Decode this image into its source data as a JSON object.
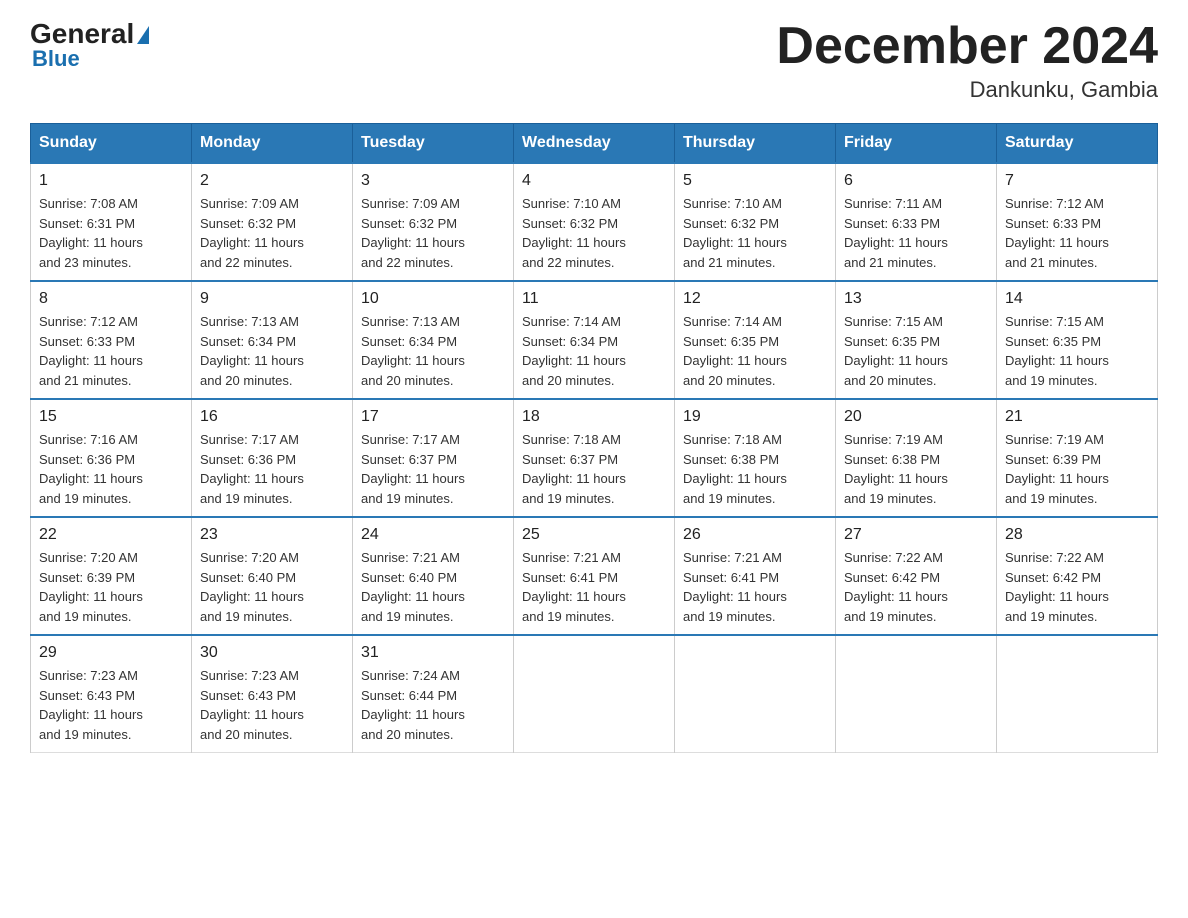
{
  "logo": {
    "general": "General",
    "blue": "Blue",
    "arrow": "▶"
  },
  "title": {
    "month_year": "December 2024",
    "location": "Dankunku, Gambia"
  },
  "headers": [
    "Sunday",
    "Monday",
    "Tuesday",
    "Wednesday",
    "Thursday",
    "Friday",
    "Saturday"
  ],
  "weeks": [
    [
      {
        "day": "1",
        "sunrise": "7:08 AM",
        "sunset": "6:31 PM",
        "daylight": "11 hours and 23 minutes."
      },
      {
        "day": "2",
        "sunrise": "7:09 AM",
        "sunset": "6:32 PM",
        "daylight": "11 hours and 22 minutes."
      },
      {
        "day": "3",
        "sunrise": "7:09 AM",
        "sunset": "6:32 PM",
        "daylight": "11 hours and 22 minutes."
      },
      {
        "day": "4",
        "sunrise": "7:10 AM",
        "sunset": "6:32 PM",
        "daylight": "11 hours and 22 minutes."
      },
      {
        "day": "5",
        "sunrise": "7:10 AM",
        "sunset": "6:32 PM",
        "daylight": "11 hours and 21 minutes."
      },
      {
        "day": "6",
        "sunrise": "7:11 AM",
        "sunset": "6:33 PM",
        "daylight": "11 hours and 21 minutes."
      },
      {
        "day": "7",
        "sunrise": "7:12 AM",
        "sunset": "6:33 PM",
        "daylight": "11 hours and 21 minutes."
      }
    ],
    [
      {
        "day": "8",
        "sunrise": "7:12 AM",
        "sunset": "6:33 PM",
        "daylight": "11 hours and 21 minutes."
      },
      {
        "day": "9",
        "sunrise": "7:13 AM",
        "sunset": "6:34 PM",
        "daylight": "11 hours and 20 minutes."
      },
      {
        "day": "10",
        "sunrise": "7:13 AM",
        "sunset": "6:34 PM",
        "daylight": "11 hours and 20 minutes."
      },
      {
        "day": "11",
        "sunrise": "7:14 AM",
        "sunset": "6:34 PM",
        "daylight": "11 hours and 20 minutes."
      },
      {
        "day": "12",
        "sunrise": "7:14 AM",
        "sunset": "6:35 PM",
        "daylight": "11 hours and 20 minutes."
      },
      {
        "day": "13",
        "sunrise": "7:15 AM",
        "sunset": "6:35 PM",
        "daylight": "11 hours and 20 minutes."
      },
      {
        "day": "14",
        "sunrise": "7:15 AM",
        "sunset": "6:35 PM",
        "daylight": "11 hours and 19 minutes."
      }
    ],
    [
      {
        "day": "15",
        "sunrise": "7:16 AM",
        "sunset": "6:36 PM",
        "daylight": "11 hours and 19 minutes."
      },
      {
        "day": "16",
        "sunrise": "7:17 AM",
        "sunset": "6:36 PM",
        "daylight": "11 hours and 19 minutes."
      },
      {
        "day": "17",
        "sunrise": "7:17 AM",
        "sunset": "6:37 PM",
        "daylight": "11 hours and 19 minutes."
      },
      {
        "day": "18",
        "sunrise": "7:18 AM",
        "sunset": "6:37 PM",
        "daylight": "11 hours and 19 minutes."
      },
      {
        "day": "19",
        "sunrise": "7:18 AM",
        "sunset": "6:38 PM",
        "daylight": "11 hours and 19 minutes."
      },
      {
        "day": "20",
        "sunrise": "7:19 AM",
        "sunset": "6:38 PM",
        "daylight": "11 hours and 19 minutes."
      },
      {
        "day": "21",
        "sunrise": "7:19 AM",
        "sunset": "6:39 PM",
        "daylight": "11 hours and 19 minutes."
      }
    ],
    [
      {
        "day": "22",
        "sunrise": "7:20 AM",
        "sunset": "6:39 PM",
        "daylight": "11 hours and 19 minutes."
      },
      {
        "day": "23",
        "sunrise": "7:20 AM",
        "sunset": "6:40 PM",
        "daylight": "11 hours and 19 minutes."
      },
      {
        "day": "24",
        "sunrise": "7:21 AM",
        "sunset": "6:40 PM",
        "daylight": "11 hours and 19 minutes."
      },
      {
        "day": "25",
        "sunrise": "7:21 AM",
        "sunset": "6:41 PM",
        "daylight": "11 hours and 19 minutes."
      },
      {
        "day": "26",
        "sunrise": "7:21 AM",
        "sunset": "6:41 PM",
        "daylight": "11 hours and 19 minutes."
      },
      {
        "day": "27",
        "sunrise": "7:22 AM",
        "sunset": "6:42 PM",
        "daylight": "11 hours and 19 minutes."
      },
      {
        "day": "28",
        "sunrise": "7:22 AM",
        "sunset": "6:42 PM",
        "daylight": "11 hours and 19 minutes."
      }
    ],
    [
      {
        "day": "29",
        "sunrise": "7:23 AM",
        "sunset": "6:43 PM",
        "daylight": "11 hours and 19 minutes."
      },
      {
        "day": "30",
        "sunrise": "7:23 AM",
        "sunset": "6:43 PM",
        "daylight": "11 hours and 20 minutes."
      },
      {
        "day": "31",
        "sunrise": "7:24 AM",
        "sunset": "6:44 PM",
        "daylight": "11 hours and 20 minutes."
      },
      null,
      null,
      null,
      null
    ]
  ],
  "labels": {
    "sunrise": "Sunrise:",
    "sunset": "Sunset:",
    "daylight": "Daylight:"
  }
}
